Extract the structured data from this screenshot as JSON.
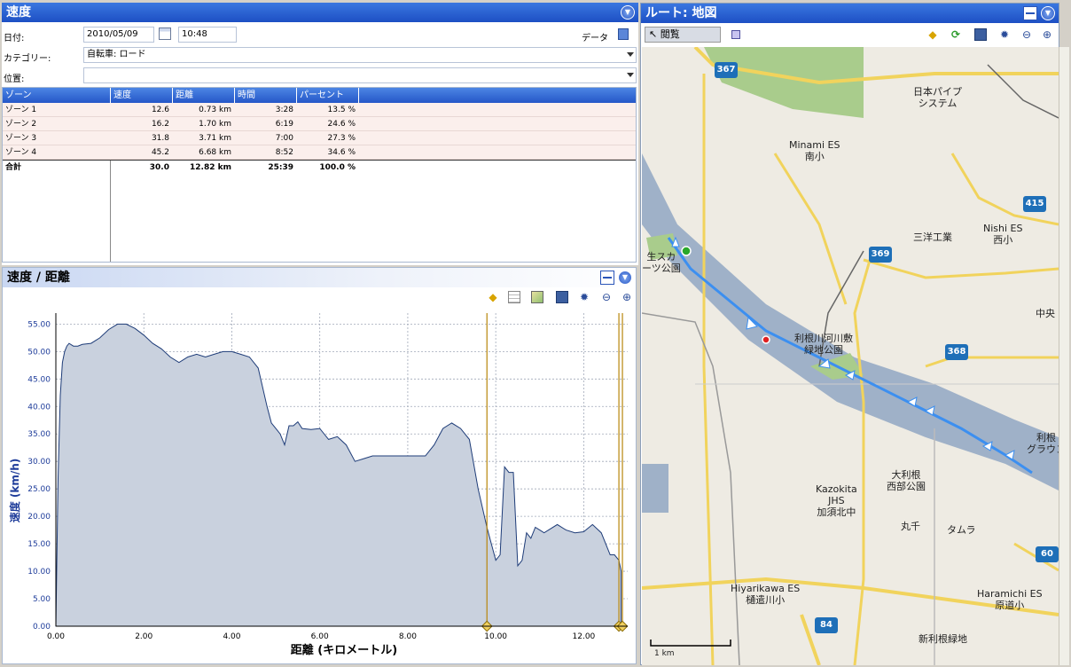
{
  "speed_panel": {
    "title": "速度",
    "date_label": "日付:",
    "date_value": "2010/05/09",
    "time_value": "10:48",
    "data_label": "データ",
    "category_label": "カテゴリー:",
    "category_value": "自転車: ロード",
    "location_label": "位置:",
    "location_value": ""
  },
  "zones": {
    "headers": [
      "ゾーン",
      "速度",
      "距離",
      "時間",
      "パーセント"
    ],
    "rows": [
      {
        "name": "ゾーン 1",
        "speed": "12.6",
        "distance": "0.73 km",
        "time": "3:28",
        "percent": "13.5 %"
      },
      {
        "name": "ゾーン 2",
        "speed": "16.2",
        "distance": "1.70 km",
        "time": "6:19",
        "percent": "24.6 %"
      },
      {
        "name": "ゾーン 3",
        "speed": "31.8",
        "distance": "3.71 km",
        "time": "7:00",
        "percent": "27.3 %"
      },
      {
        "name": "ゾーン 4",
        "speed": "45.2",
        "distance": "6.68 km",
        "time": "8:52",
        "percent": "34.6 %"
      }
    ],
    "total": {
      "name": "合計",
      "speed": "30.0",
      "distance": "12.82 km",
      "time": "25:39",
      "percent": "100.0 %"
    }
  },
  "chart_panel": {
    "title": "速度 / 距離"
  },
  "chart_data": {
    "type": "area",
    "xlabel": "距離 (キロメートル)",
    "ylabel": "速度 (km/h)",
    "xlim": [
      0,
      13
    ],
    "ylim": [
      0,
      57
    ],
    "xticks": [
      "0.00",
      "2.00",
      "4.00",
      "6.00",
      "8.00",
      "10.00",
      "12.00"
    ],
    "yticks": [
      "0.00",
      "5.00",
      "10.00",
      "15.00",
      "20.00",
      "25.00",
      "30.00",
      "35.00",
      "40.00",
      "45.00",
      "50.00",
      "55.00"
    ],
    "grid": true,
    "series": [
      {
        "x": [
          0,
          0.05,
          0.1,
          0.15,
          0.2,
          0.25,
          0.3,
          0.4,
          0.5,
          0.6,
          0.8,
          1.0,
          1.2,
          1.4,
          1.6,
          1.8,
          2.0,
          2.2,
          2.4,
          2.6,
          2.8,
          3.0,
          3.2,
          3.4,
          3.6,
          3.8,
          4.0,
          4.2,
          4.4,
          4.6,
          4.8,
          4.9,
          5.0,
          5.1,
          5.2,
          5.3,
          5.4,
          5.5,
          5.6,
          5.8,
          6.0,
          6.2,
          6.4,
          6.6,
          6.8,
          7.0,
          7.2,
          7.4,
          7.6,
          7.8,
          8.0,
          8.2,
          8.4,
          8.6,
          8.8,
          9.0,
          9.2,
          9.4,
          9.6,
          9.8,
          10.0,
          10.1,
          10.2,
          10.3,
          10.4,
          10.5,
          10.6,
          10.7,
          10.8,
          10.9,
          11.0,
          11.1,
          11.2,
          11.4,
          11.6,
          11.8,
          12.0,
          12.2,
          12.4,
          12.5,
          12.6,
          12.7,
          12.8,
          12.85
        ],
        "y": [
          0,
          27,
          42,
          48,
          50,
          51,
          51.5,
          51,
          51,
          51.3,
          51.5,
          52.5,
          54,
          55,
          55,
          54.2,
          53,
          51.5,
          50.5,
          49,
          48,
          49,
          49.5,
          49,
          49.5,
          50,
          50,
          49.5,
          49,
          47,
          40,
          37,
          36,
          35,
          33,
          36.5,
          36.5,
          37.2,
          36,
          35.8,
          36,
          34,
          34.5,
          33,
          30,
          30.5,
          31,
          31,
          31,
          31,
          31,
          31,
          31,
          33,
          36,
          37,
          36,
          34,
          25,
          18,
          12,
          13,
          29,
          28,
          28,
          11,
          12,
          17,
          16,
          18,
          17.5,
          17,
          17.5,
          18.5,
          17.5,
          17,
          17.2,
          18.5,
          17,
          15,
          13,
          13,
          12,
          10
        ]
      }
    ],
    "markers_x": [
      9.8,
      12.8,
      12.88
    ]
  },
  "map_panel": {
    "title": "ルート: 地図",
    "view_label": "閲覧",
    "scale_label": "1 km",
    "labels": [
      {
        "text": "日本パイプ\nシステム"
      },
      {
        "text": "Minami ES\n南小"
      },
      {
        "text": "三洋工業"
      },
      {
        "text": "Nishi ES\n西小"
      },
      {
        "text": "中央"
      },
      {
        "text": "利根川河川敷\n緑地公園"
      },
      {
        "text": "生スカ\nーツ公園"
      },
      {
        "text": "大利根\n西部公園"
      },
      {
        "text": "Kazokita\nJHS\n加須北中"
      },
      {
        "text": "丸千"
      },
      {
        "text": "タムラ"
      },
      {
        "text": "Hiyarikawa ES\n樋遣川小"
      },
      {
        "text": "Haramichi ES\n原道小"
      },
      {
        "text": "新利根緑地"
      },
      {
        "text": "利根\nグラウン"
      }
    ],
    "roads": [
      "367",
      "369",
      "368",
      "415",
      "60",
      "84"
    ]
  }
}
